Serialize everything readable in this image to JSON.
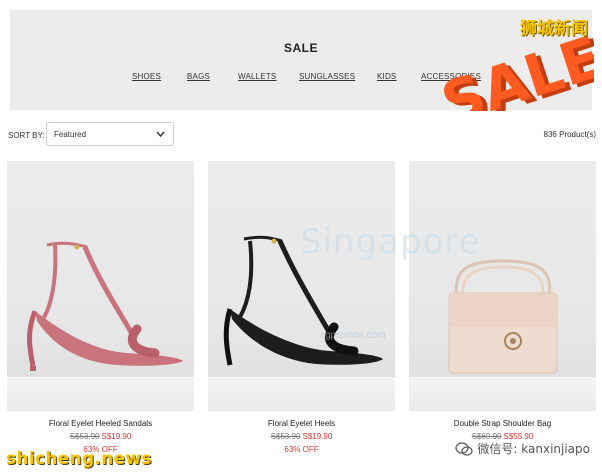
{
  "header": {
    "title": "SALE",
    "nav": [
      "SHOES",
      "BAGS",
      "WALLETS",
      "SUNGLASSES",
      "KIDS",
      "ACCESSORIES"
    ],
    "sale_art_text": "SALE"
  },
  "toolbar": {
    "sort_label": "SORT BY:",
    "sort_value": "Featured",
    "product_count": "836 Product(s)"
  },
  "products": [
    {
      "name": "Floral Eyelet Heeled Sandals",
      "old_price": "S$53.90",
      "new_price": "S$19.90",
      "discount": "63% OFF",
      "color": "#c9737c"
    },
    {
      "name": "Floral Eyelet Heels",
      "old_price": "S$53.90",
      "new_price": "S$19.90",
      "discount": "63% OFF",
      "color": "#1d1d1d"
    },
    {
      "name": "Double Strap Shoulder Bag",
      "old_price": "S$69.90",
      "new_price": "S$55.90",
      "discount": "",
      "color": "#e9d4c6"
    }
  ],
  "watermarks": {
    "top_right": "狮城新闻",
    "background": "Singapore",
    "background_sub": "sgpromos.com",
    "site": "shicheng.news",
    "wechat": "微信号: kanxinjiapo"
  },
  "colors": {
    "sale_accent": "#ff5a1f",
    "price_red": "#d33a3a"
  }
}
